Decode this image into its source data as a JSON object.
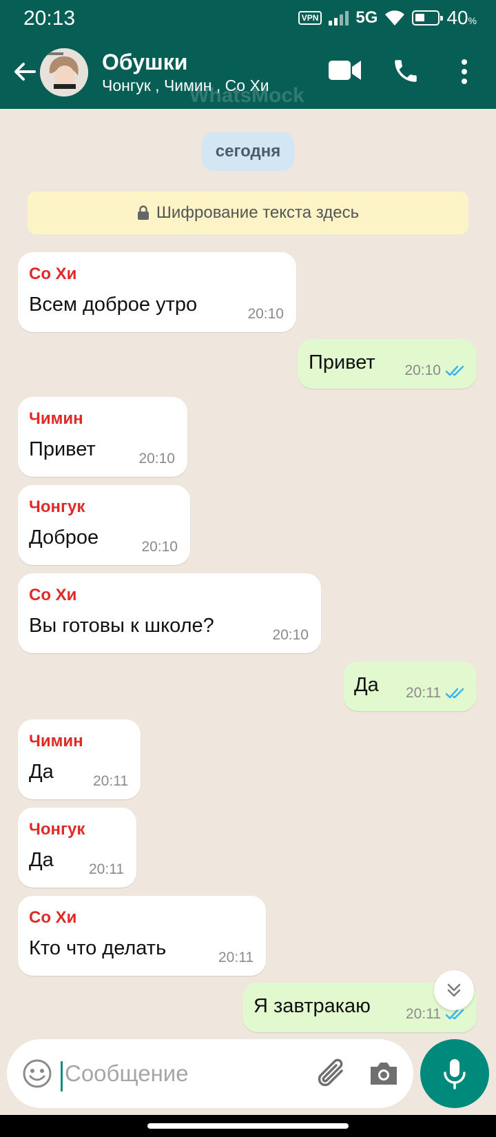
{
  "status_bar": {
    "time": "20:13",
    "vpn": "VPN",
    "network": "5G",
    "battery": "40",
    "battery_unit": "%"
  },
  "header": {
    "title": "Обушки",
    "subtitle": "Чонгук , Чимин , Со Хи",
    "watermark": "WhatsMock",
    "icons": [
      "back-arrow-icon",
      "video-call-icon",
      "phone-call-icon",
      "more-vert-icon"
    ]
  },
  "chat": {
    "date_chip": "сегодня",
    "encryption_notice": "Шифрование текста здесь",
    "messages": [
      {
        "direction": "in",
        "sender": "Со Хи",
        "text": "Всем доброе утро",
        "time": "20:10"
      },
      {
        "direction": "out",
        "text": "Привет",
        "time": "20:10",
        "status": "read"
      },
      {
        "direction": "in",
        "sender": "Чимин",
        "text": "Привет",
        "time": "20:10"
      },
      {
        "direction": "in",
        "sender": "Чонгук",
        "text": "Доброе",
        "time": "20:10"
      },
      {
        "direction": "in",
        "sender": "Со Хи",
        "text": "Вы готовы к школе?",
        "time": "20:10"
      },
      {
        "direction": "out",
        "text": "Да",
        "time": "20:11",
        "status": "read"
      },
      {
        "direction": "in",
        "sender": "Чимин",
        "text": "Да",
        "time": "20:11"
      },
      {
        "direction": "in",
        "sender": "Чонгук",
        "text": "Да",
        "time": "20:11"
      },
      {
        "direction": "in",
        "sender": "Со Хи",
        "text": "Кто что делать",
        "time": "20:11"
      },
      {
        "direction": "out",
        "text": "Я завтракаю",
        "time": "20:11",
        "status": "read"
      }
    ]
  },
  "composer": {
    "placeholder": "Сообщение",
    "value": ""
  },
  "colors": {
    "header": "#075e54",
    "chat_bg": "#efe7de",
    "outgoing": "#e2f8ce",
    "sender_name": "#e02a2a",
    "read_ticks": "#34b7f1",
    "mic_button": "#008a7c"
  }
}
